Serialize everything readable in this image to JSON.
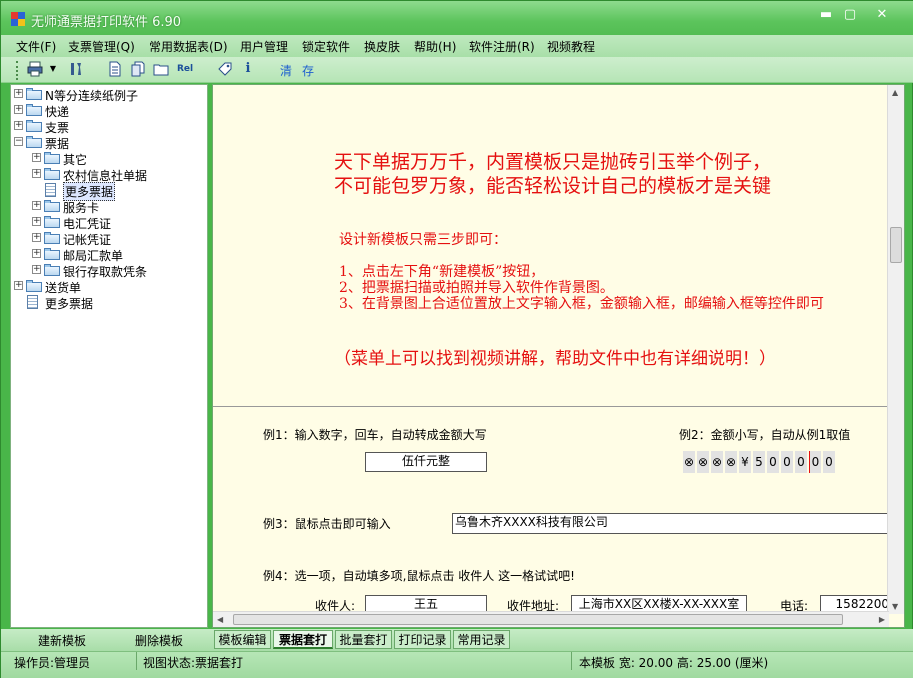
{
  "window": {
    "title": "无师通票据打印软件 6.90",
    "minimize": "▬",
    "maximize": "▢",
    "close": "✕"
  },
  "menu": [
    "文件(F)",
    "支票管理(Q)",
    "常用数据表(D)",
    "用户管理",
    "锁定软件",
    "换皮肤",
    "帮助(H)",
    "软件注册(R)",
    "视频教程"
  ],
  "toolbar": {
    "icons": [
      "printer-icon",
      "tools-icon",
      "document-icon",
      "copy-icon",
      "folder-icon",
      "rel-icon",
      "tag-icon",
      "info-icon"
    ],
    "rel_label": "Rel",
    "info_label": "i",
    "clear_label": "清",
    "save_label": "存"
  },
  "tree": [
    {
      "label": "N等分连续纸例子",
      "level": 0,
      "expand": "+",
      "type": "folder"
    },
    {
      "label": "快递",
      "level": 0,
      "expand": "+",
      "type": "folder"
    },
    {
      "label": "支票",
      "level": 0,
      "expand": "+",
      "type": "folder"
    },
    {
      "label": "票据",
      "level": 0,
      "expand": "−",
      "type": "folder"
    },
    {
      "label": "其它",
      "level": 1,
      "expand": "+",
      "type": "folder"
    },
    {
      "label": "农村信息社单据",
      "level": 1,
      "expand": "+",
      "type": "folder"
    },
    {
      "label": "更多票据",
      "level": 1,
      "expand": "",
      "type": "doc",
      "selected": true
    },
    {
      "label": "服务卡",
      "level": 1,
      "expand": "+",
      "type": "folder"
    },
    {
      "label": "电汇凭证",
      "level": 1,
      "expand": "+",
      "type": "folder"
    },
    {
      "label": "记帐凭证",
      "level": 1,
      "expand": "+",
      "type": "folder"
    },
    {
      "label": "邮局汇款单",
      "level": 1,
      "expand": "+",
      "type": "folder"
    },
    {
      "label": "银行存取款凭条",
      "level": 1,
      "expand": "+",
      "type": "folder"
    },
    {
      "label": "送货单",
      "level": 0,
      "expand": "+",
      "type": "folder"
    },
    {
      "label": "更多票据",
      "level": 0,
      "expand": "",
      "type": "doc"
    }
  ],
  "content": {
    "headline1": "天下单据万万千，内置模板只是抛砖引玉举个例子，",
    "headline2": "不可能包罗万象，能否轻松设计自己的模板才是关键",
    "steps_title": "设计新模板只需三步即可：",
    "step1": "1、点击左下角“新建模板”按钮，",
    "step2": "2、把票据扫描或拍照并导入软件作背景图。",
    "step3": "3、在背景图上合适位置放上文字输入框，金额输入框，邮编输入框等控件即可",
    "note": "（菜单上可以找到视频讲解，帮助文件中也有详细说明！）",
    "ex1_label": "例1：输入数字，回车，自动转成金额大写",
    "ex1_value": "伍仟元整",
    "ex2_label": "例2：金额小写，自动从例1取值",
    "ex2_digits": [
      "⊗",
      "⊗",
      "⊗",
      "⊗",
      "¥",
      "5",
      "0",
      "0",
      "0",
      "0",
      "0"
    ],
    "ex3_label": "例3：鼠标点击即可输入",
    "ex3_value": "乌鲁木齐XXXX科技有限公司",
    "ex4_label": "例4：选一项，自动填多项,鼠标点击 收件人 这一格试试吧!",
    "recipient_label": "收件人:",
    "recipient_value": "王五",
    "address_label": "收件地址:",
    "address_value": "上海市XX区XX楼X-XX-XXX室",
    "phone_label": "电话:",
    "phone_value": "1582200"
  },
  "bottom": {
    "new_template": "建新模板",
    "delete_template": "删除模板",
    "tabs": [
      "模板编辑",
      "票据套打",
      "批量套打",
      "打印记录",
      "常用记录"
    ],
    "active_tab": "票据套打"
  },
  "status": {
    "operator": "操作员:管理员",
    "view_state": "视图状态:票据套打",
    "template_size": "本模板 宽: 20.00 高: 25.00 (厘米)"
  },
  "colors": {
    "accent_red": "#e51010",
    "panel_bg": "#fffde6",
    "window_green": "#49b649"
  }
}
